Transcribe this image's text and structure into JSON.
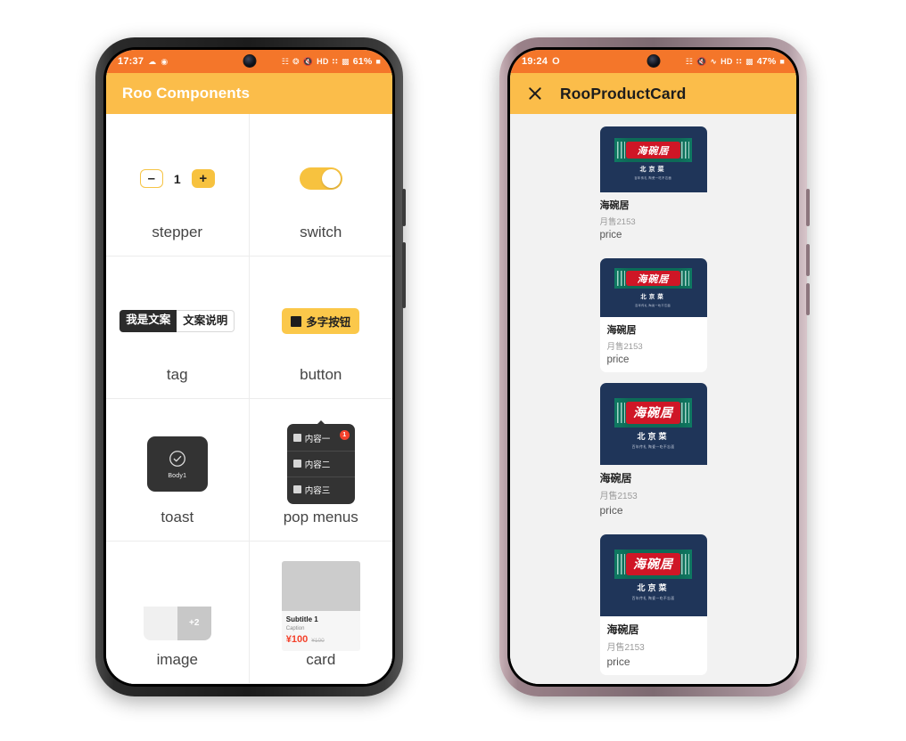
{
  "left_phone": {
    "frame_color": "#1c1c1c",
    "status_bar": {
      "time": "17:37",
      "battery": "61%",
      "icons": [
        "cloud-upload-icon",
        "app-icon",
        "network-speed-icon",
        "bluetooth-icon",
        "mute-icon",
        "hd-icon",
        "dual-sim-icon",
        "signal-icon",
        "battery-icon"
      ],
      "bg_color": "#F4762A"
    },
    "appbar": {
      "title": "Roo Components",
      "bg_color": "#FBBD4A",
      "text_color": "#ffffff"
    },
    "grid": [
      {
        "label": "stepper",
        "type": "stepper",
        "minus": "–",
        "value": "1",
        "plus": "+"
      },
      {
        "label": "switch",
        "type": "switch",
        "state": "on"
      },
      {
        "label": "tag",
        "type": "tag",
        "tag_dark": "我是文案",
        "tag_light": "文案说明"
      },
      {
        "label": "button",
        "type": "button",
        "button_label": "多字按钮"
      },
      {
        "label": "toast",
        "type": "toast",
        "toast_text": "Body1"
      },
      {
        "label": "pop menus",
        "type": "popmenu",
        "items": [
          "内容一",
          "内容二",
          "内容三"
        ],
        "badge": "1"
      },
      {
        "label": "image",
        "type": "image",
        "overlay": "+2"
      },
      {
        "label": "card",
        "type": "card",
        "subtitle": "Subtitle 1",
        "caption": "Caption",
        "price": "¥100",
        "old_price": "¥100"
      }
    ]
  },
  "right_phone": {
    "frame_color": "#9a8189",
    "status_bar": {
      "time": "19:24",
      "battery": "47%",
      "icons": [
        "circle-icon",
        "network-speed-icon",
        "mute-icon",
        "wifi-icon",
        "hd-icon",
        "dual-sim-icon",
        "signal-icon",
        "battery-icon"
      ],
      "bg_color": "#F4762A"
    },
    "appbar": {
      "title": "RooProductCard",
      "close_icon": "close-icon",
      "bg_color": "#FBBD4A",
      "text_color": "#1d1d1d"
    },
    "list_bg": "#f2f2f2",
    "products": [
      {
        "name": "海碗居",
        "sales": "月售2153",
        "price": "price",
        "logo_title": "海碗居",
        "logo_cn": "北京菜",
        "logo_sub": "百年传礼 陶瓷一吃不忘面",
        "boxed": false,
        "size": "small"
      },
      {
        "name": "海碗居",
        "sales": "月售2153",
        "price": "price",
        "logo_title": "海碗居",
        "logo_cn": "北京菜",
        "logo_sub": "百年传礼 陶瓷一吃不忘面",
        "boxed": true,
        "size": "small"
      },
      {
        "name": "海碗居",
        "sales": "月售2153",
        "price": "price",
        "logo_title": "海碗居",
        "logo_cn": "北京菜",
        "logo_sub": "百年传礼 陶瓷一吃不忘面",
        "boxed": false,
        "size": "large"
      },
      {
        "name": "海碗居",
        "sales": "月售2153",
        "price": "price",
        "logo_title": "海碗居",
        "logo_cn": "北京菜",
        "logo_sub": "百年传礼 陶瓷一吃不忘面",
        "boxed": true,
        "size": "large"
      }
    ]
  }
}
